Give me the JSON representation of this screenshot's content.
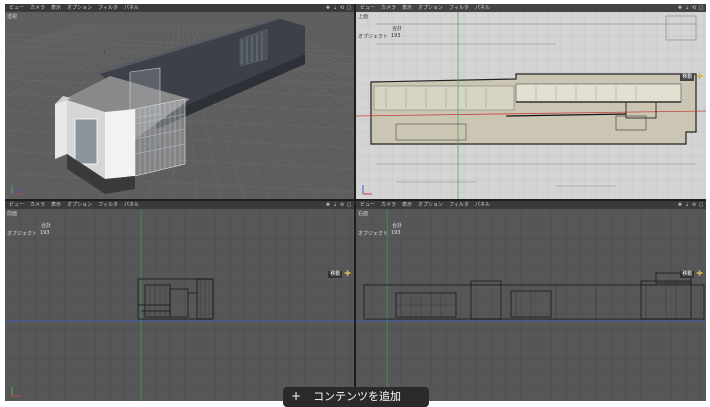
{
  "menu": [
    "ビュー",
    "カメラ",
    "表示",
    "オプション",
    "フィルタ",
    "パネル"
  ],
  "viewports": {
    "perspective": {
      "label": "透視"
    },
    "top": {
      "label": "上面"
    },
    "front": {
      "label": "前面"
    },
    "right": {
      "label": "右面"
    }
  },
  "hud": {
    "header": "合計",
    "object_label": "オブジェクト",
    "object_count": "193"
  },
  "move_label": "移動",
  "toast": {
    "plus": "+",
    "text": "コンテンツを追加"
  },
  "colors": {
    "grid_dark": "#4a4a4a",
    "grid_light": "#bdbdbd",
    "axis_red": "#c84040",
    "axis_green": "#4caf50",
    "axis_blue": "#4060d0",
    "accent_yellow": "#d8b24a"
  }
}
